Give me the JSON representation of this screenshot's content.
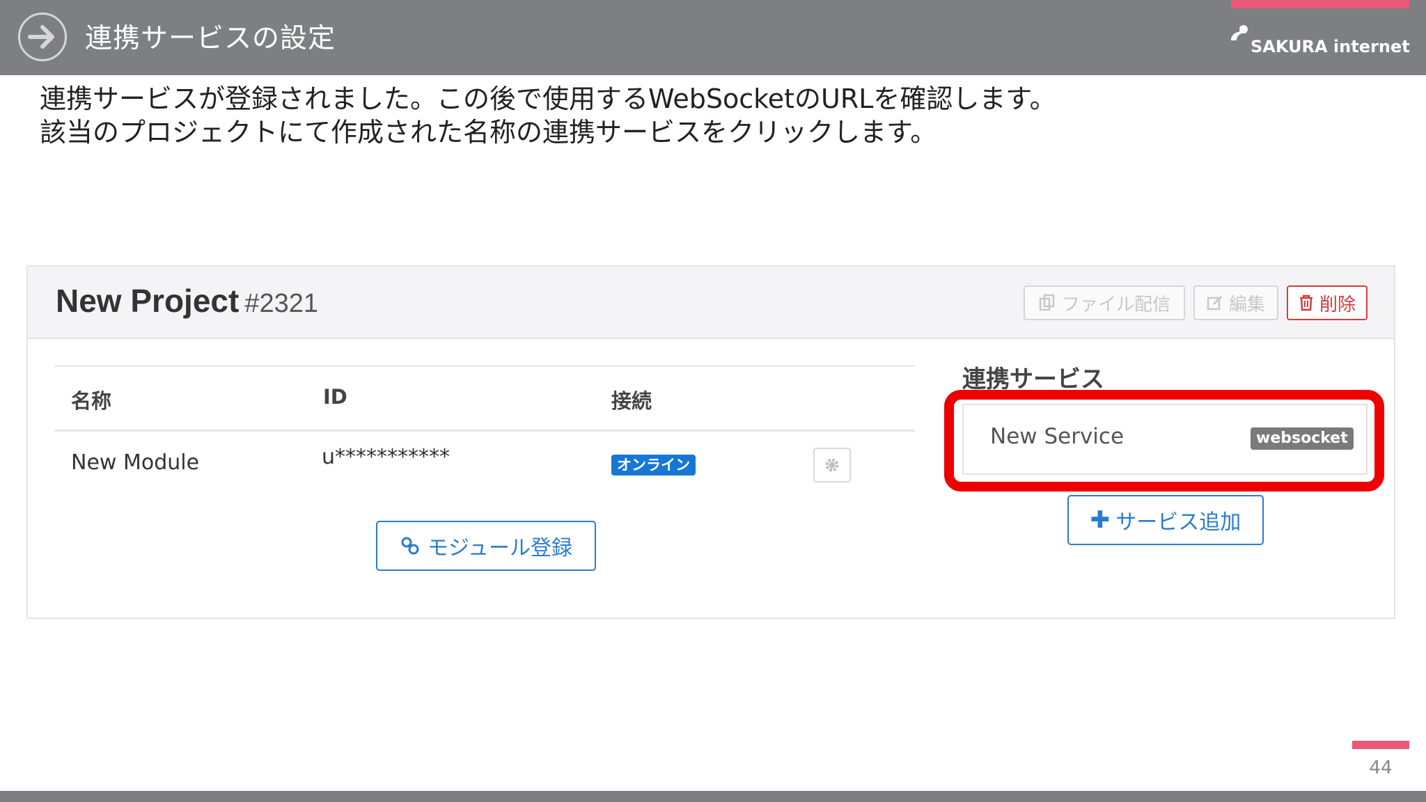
{
  "slide": {
    "title": "連携サービスの設定",
    "logo_text": "SAKURA internet",
    "description_line1": "連携サービスが登録されました。この後で使用するWebSocketのURLを確認します。",
    "description_line2": "該当のプロジェクトにて作成された名称の連携サービスをクリックします。",
    "page_number": "44",
    "accent_color": "#e85a77",
    "header_color": "#7e7f82"
  },
  "project": {
    "name": "New Project",
    "id": "#2321",
    "buttons": {
      "file": "ファイル配信",
      "edit": "編集",
      "delete": "削除"
    }
  },
  "table": {
    "headers": {
      "name": "名称",
      "id": "ID",
      "connection": "接続"
    },
    "rows": [
      {
        "name": "New Module",
        "id": "u***********",
        "status": "オンライン"
      }
    ],
    "register_button": "モジュール登録"
  },
  "services": {
    "heading": "連携サービス",
    "items": [
      {
        "name": "New Service",
        "type": "websocket"
      }
    ],
    "add_button": "サービス追加",
    "highlight_color": "#ee0000"
  }
}
